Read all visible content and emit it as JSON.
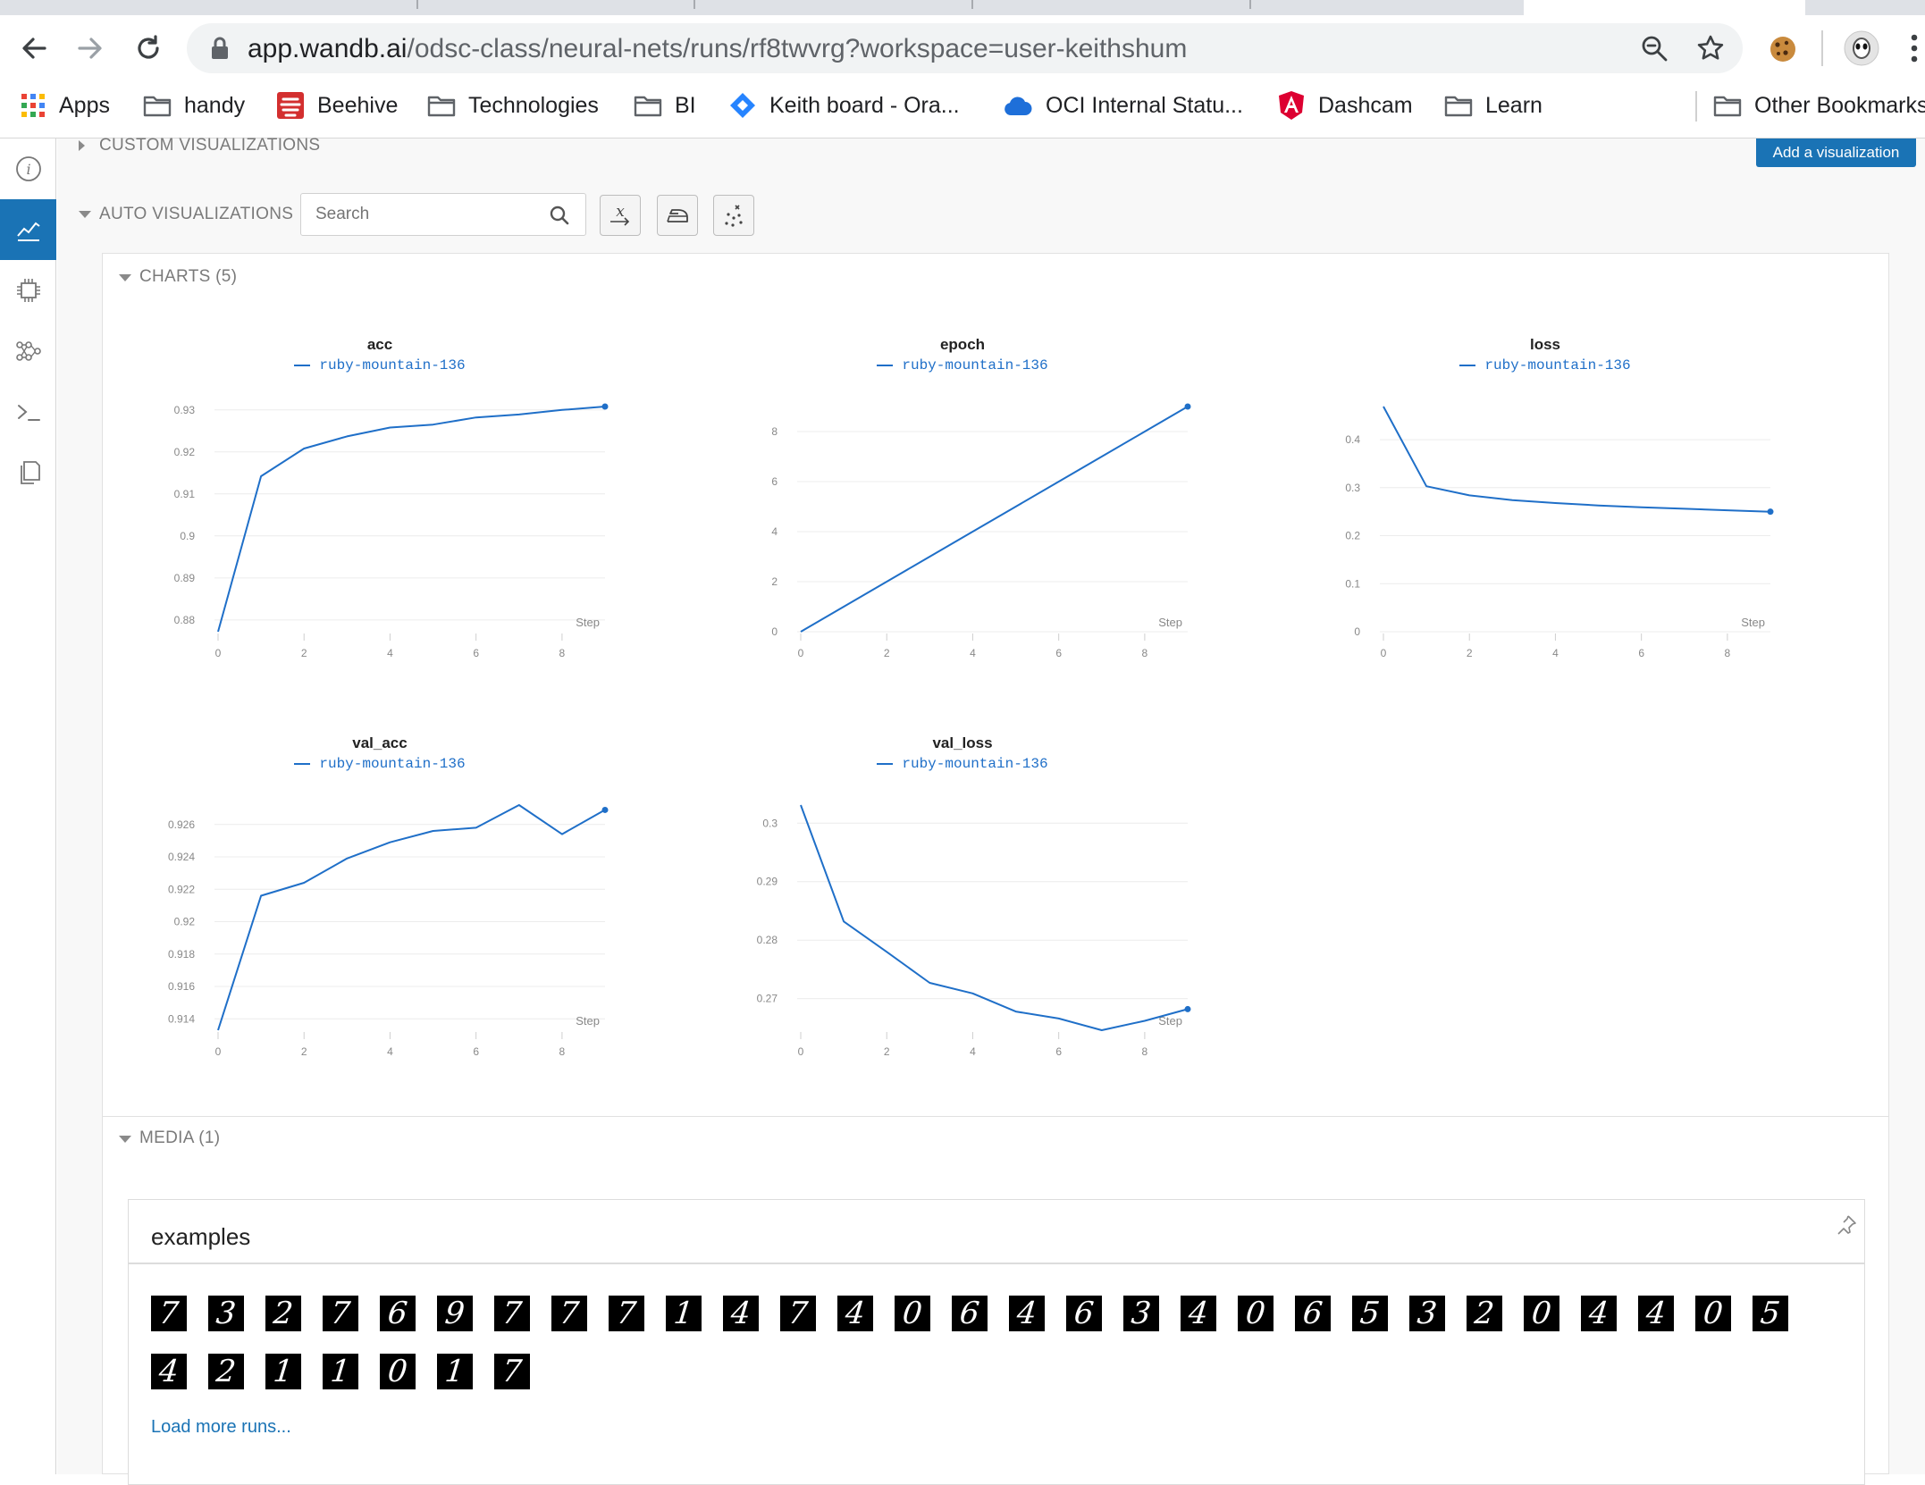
{
  "browser": {
    "url_host": "app.wandb.ai",
    "url_path": "/odsc-class/neural-nets/runs/rf8twvrg?workspace=user-keithshum",
    "bookmarks": [
      {
        "label": "Apps",
        "icon": "apps-grid-icon"
      },
      {
        "label": "handy",
        "icon": "folder-icon"
      },
      {
        "label": "Beehive",
        "icon": "beehive-icon"
      },
      {
        "label": "Technologies",
        "icon": "folder-icon"
      },
      {
        "label": "BI",
        "icon": "folder-icon"
      },
      {
        "label": "Keith board - Ora...",
        "icon": "jira-icon"
      },
      {
        "label": "OCI Internal Statu...",
        "icon": "cloud-icon"
      },
      {
        "label": "Dashcam",
        "icon": "angular-icon"
      },
      {
        "label": "Learn",
        "icon": "folder-icon"
      },
      {
        "label": "Other Bookmarks",
        "icon": "folder-icon"
      }
    ]
  },
  "sections": {
    "custom_label": "CUSTOM VISUALIZATIONS",
    "add_viz_label": "Add a visualization",
    "auto_label": "AUTO VISUALIZATIONS",
    "search_placeholder": "Search",
    "charts_label": "CHARTS (5)",
    "media_label": "MEDIA (1)"
  },
  "media": {
    "title": "examples",
    "digits": [
      "7",
      "3",
      "2",
      "7",
      "6",
      "9",
      "7",
      "7",
      "7",
      "1",
      "4",
      "7",
      "4",
      "0",
      "6",
      "4",
      "6",
      "3",
      "4",
      "0",
      "6",
      "5",
      "3",
      "2",
      "0",
      "4",
      "4",
      "0",
      "5",
      "4",
      "2",
      "1",
      "1",
      "0",
      "1",
      "7"
    ],
    "load_more": "Load more runs..."
  },
  "colors": {
    "accent": "#1f6fc8",
    "button": "#1a73b5"
  },
  "chart_data": [
    {
      "type": "line",
      "title": "acc",
      "xlabel": "Step",
      "series": [
        {
          "name": "ruby-mountain-136",
          "x": [
            0,
            1,
            2,
            3,
            4,
            5,
            6,
            7,
            8,
            9
          ],
          "y": [
            0.8772,
            0.9142,
            0.9208,
            0.9237,
            0.9258,
            0.9265,
            0.9282,
            0.9289,
            0.93,
            0.9308
          ]
        }
      ],
      "xlim": [
        0,
        9
      ],
      "ylim": [
        0.8772,
        0.9308
      ],
      "xticks": [
        "0",
        "2",
        "4",
        "6",
        "8"
      ],
      "yticks": [
        "0.88",
        "0.89",
        "0.9",
        "0.91",
        "0.92",
        "0.93"
      ],
      "ytick_values": [
        0.88,
        0.89,
        0.9,
        0.91,
        0.92,
        0.93
      ]
    },
    {
      "type": "line",
      "title": "epoch",
      "xlabel": "Step",
      "series": [
        {
          "name": "ruby-mountain-136",
          "x": [
            0,
            1,
            2,
            3,
            4,
            5,
            6,
            7,
            8,
            9
          ],
          "y": [
            0,
            1,
            2,
            3,
            4,
            5,
            6,
            7,
            8,
            9
          ]
        }
      ],
      "xlim": [
        0,
        9
      ],
      "ylim": [
        0,
        9
      ],
      "xticks": [
        "0",
        "2",
        "4",
        "6",
        "8"
      ],
      "yticks": [
        "0",
        "2",
        "4",
        "6",
        "8"
      ],
      "ytick_values": [
        0,
        2,
        4,
        6,
        8
      ]
    },
    {
      "type": "line",
      "title": "loss",
      "xlabel": "Step",
      "series": [
        {
          "name": "ruby-mountain-136",
          "x": [
            0,
            1,
            2,
            3,
            4,
            5,
            6,
            7,
            8,
            9
          ],
          "y": [
            0.469,
            0.303,
            0.284,
            0.274,
            0.268,
            0.263,
            0.259,
            0.256,
            0.253,
            0.25
          ]
        }
      ],
      "xlim": [
        0,
        9
      ],
      "ylim": [
        0,
        0.469
      ],
      "xticks": [
        "0",
        "2",
        "4",
        "6",
        "8"
      ],
      "yticks": [
        "0",
        "0.1",
        "0.2",
        "0.3",
        "0.4"
      ],
      "ytick_values": [
        0,
        0.1,
        0.2,
        0.3,
        0.4
      ]
    },
    {
      "type": "line",
      "title": "val_acc",
      "xlabel": "Step",
      "series": [
        {
          "name": "ruby-mountain-136",
          "x": [
            0,
            1,
            2,
            3,
            4,
            5,
            6,
            7,
            8,
            9
          ],
          "y": [
            0.9133,
            0.9216,
            0.9224,
            0.9239,
            0.9249,
            0.9256,
            0.9258,
            0.9272,
            0.9254,
            0.9269
          ]
        }
      ],
      "xlim": [
        0,
        9
      ],
      "ylim": [
        0.9133,
        0.9272
      ],
      "xticks": [
        "0",
        "2",
        "4",
        "6",
        "8"
      ],
      "yticks": [
        "0.914",
        "0.916",
        "0.918",
        "0.92",
        "0.922",
        "0.924",
        "0.926"
      ],
      "ytick_values": [
        0.914,
        0.916,
        0.918,
        0.92,
        0.922,
        0.924,
        0.926
      ]
    },
    {
      "type": "line",
      "title": "val_loss",
      "xlabel": "Step",
      "series": [
        {
          "name": "ruby-mountain-136",
          "x": [
            0,
            1,
            2,
            3,
            4,
            5,
            6,
            7,
            8,
            9
          ],
          "y": [
            0.3031,
            0.2832,
            0.278,
            0.2727,
            0.2709,
            0.2678,
            0.2666,
            0.2646,
            0.2662,
            0.2682
          ]
        }
      ],
      "xlim": [
        0,
        9
      ],
      "ylim": [
        0.2646,
        0.3031
      ],
      "xticks": [
        "0",
        "2",
        "4",
        "6",
        "8"
      ],
      "yticks": [
        "0.27",
        "0.28",
        "0.29",
        "0.3"
      ],
      "ytick_values": [
        0.27,
        0.28,
        0.29,
        0.3
      ]
    }
  ]
}
